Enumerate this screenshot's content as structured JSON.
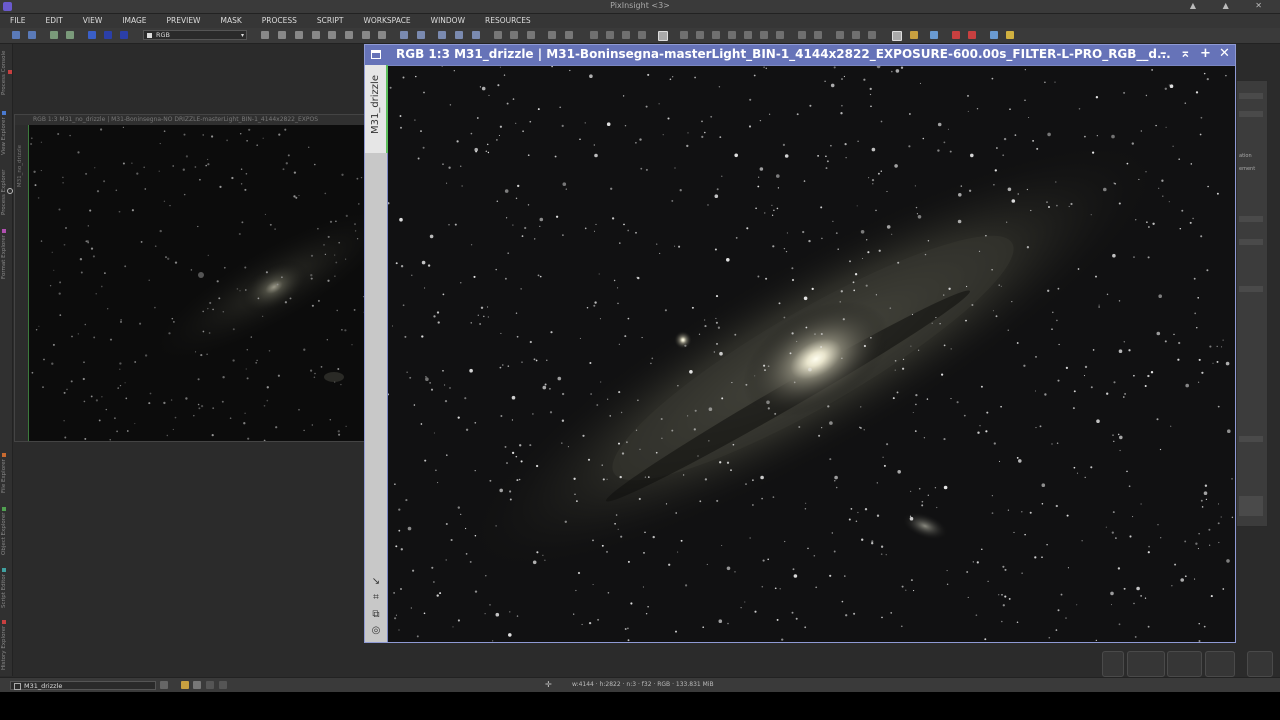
{
  "app": {
    "title": "PixInsight <3>",
    "window_controls": "▲ ▲ ✕"
  },
  "menubar": {
    "items": [
      "FILE",
      "EDIT",
      "VIEW",
      "IMAGE",
      "PREVIEW",
      "MASK",
      "PROCESS",
      "SCRIPT",
      "WORKSPACE",
      "WINDOW",
      "RESOURCES"
    ]
  },
  "toolbar": {
    "color_space_value": "RGB",
    "icons": [
      "undo-icon",
      "redo-icon",
      "readout-icon",
      "nav-icon",
      "zoom-in-icon",
      "zoom-out-icon",
      "fit-icon",
      "pan-icon",
      "select-icon",
      "mask-icon",
      "stf-icon",
      "screen-icon"
    ]
  },
  "left_dock": {
    "tabs": [
      "Process Console",
      "View Explorer",
      "Process Explorer",
      "Format Explorer",
      "File Explorer",
      "Object Explorer",
      "Script Editor",
      "History Explorer"
    ]
  },
  "background_window": {
    "title": "RGB 1:3 M31_no_drizzle | M31-Boninsegna-NO DRIZZLE-masterLight_BIN-1_4144x2822_EXPOS",
    "side_label": "M31_no_drizzle"
  },
  "main_window": {
    "title": "RGB 1:3 M31_drizzle | M31-Boninsegna-masterLight_BIN-1_4144x2822_EXPOSURE-600.00s_FILTER-L-PRO_RGB__d...",
    "side_tab_label": "M31_drizzle",
    "controls": {
      "minimize": "–",
      "shade": "⌅",
      "maximize": "+",
      "close": "✕"
    }
  },
  "right_dock": {
    "labels": [
      "ation",
      "ement"
    ]
  },
  "statusbar": {
    "view_selector": "M31_drizzle",
    "info": "w:4144 · h:2822 · n:3 · f32 · RGB · 133.831 MiB"
  },
  "colors": {
    "window_title_active": "#6673b8",
    "accent_green": "#5dbf5d",
    "workspace": "#2b2b2b"
  }
}
